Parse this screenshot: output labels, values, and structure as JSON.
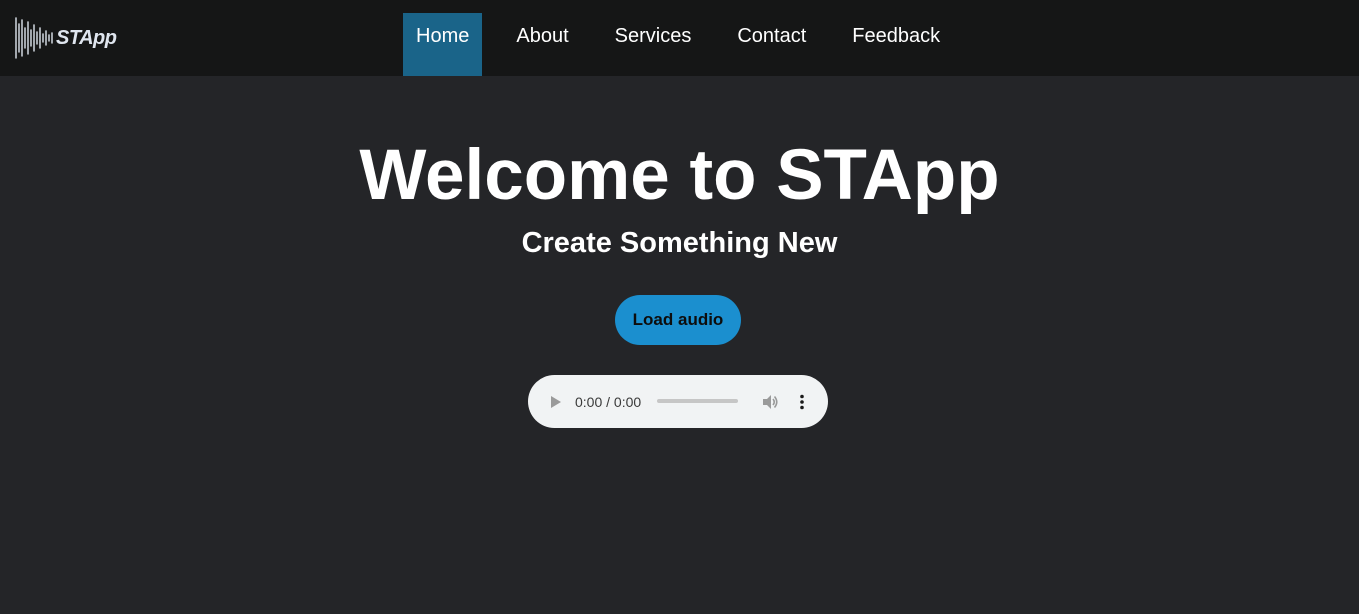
{
  "brand": {
    "name": "STApp"
  },
  "nav": {
    "items": [
      {
        "label": "Home",
        "active": true
      },
      {
        "label": "About",
        "active": false
      },
      {
        "label": "Services",
        "active": false
      },
      {
        "label": "Contact",
        "active": false
      },
      {
        "label": "Feedback",
        "active": false
      }
    ]
  },
  "hero": {
    "title": "Welcome to STApp",
    "subtitle": "Create Something New"
  },
  "audio": {
    "load_label": "Load audio",
    "time": "0:00 / 0:00",
    "progress": 0
  },
  "colors": {
    "page_bg": "#242528",
    "navbar_bg": "#151616",
    "nav_active_bg": "#1a6489",
    "button_bg": "#1b8fcf",
    "player_bg": "#f1f3f4"
  },
  "icons": {
    "logo": "waveform-icon",
    "play": "play-icon",
    "volume": "volume-icon",
    "more": "more-vertical-icon"
  }
}
